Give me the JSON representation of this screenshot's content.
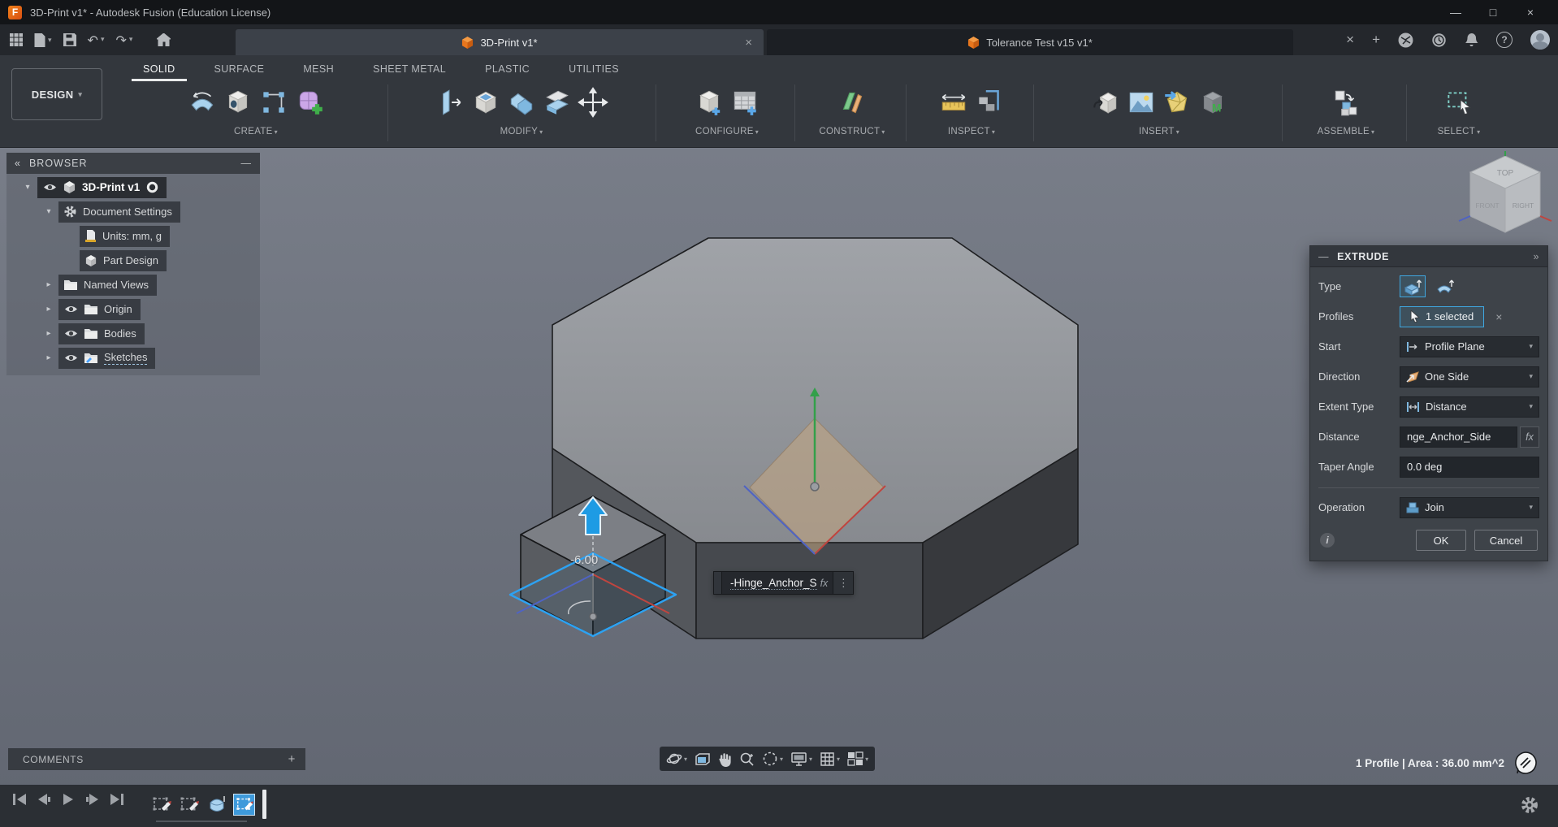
{
  "window": {
    "title": "3D-Print v1* - Autodesk Fusion (Education License)"
  },
  "icons": {
    "caret": "▾",
    "chevron": "▸",
    "close": "×",
    "add": "+",
    "minus": "—",
    "collapse_left": "«",
    "expand_right": "»",
    "kebab": "⋮",
    "help": "?",
    "window_min": "—",
    "window_max": "□",
    "window_close": "×",
    "undo": "↶",
    "redo": "↷",
    "info": "i"
  },
  "doc_tabs": {
    "tabs": [
      {
        "label": "3D-Print v1*"
      },
      {
        "label": "Tolerance Test v15 v1*"
      }
    ]
  },
  "ribbon": {
    "workspace": "DESIGN",
    "tabs": [
      {
        "label": "SOLID"
      },
      {
        "label": "SURFACE"
      },
      {
        "label": "MESH"
      },
      {
        "label": "SHEET METAL"
      },
      {
        "label": "PLASTIC"
      },
      {
        "label": "UTILITIES"
      }
    ],
    "groups": [
      {
        "label": "CREATE"
      },
      {
        "label": "MODIFY"
      },
      {
        "label": "CONFIGURE"
      },
      {
        "label": "CONSTRUCT"
      },
      {
        "label": "INSPECT"
      },
      {
        "label": "INSERT"
      },
      {
        "label": "ASSEMBLE"
      },
      {
        "label": "SELECT"
      }
    ]
  },
  "browser": {
    "header": "BROWSER",
    "items": [
      {
        "label": "3D-Print v1"
      },
      {
        "label": "Document Settings"
      },
      {
        "label": "Units: mm, g"
      },
      {
        "label": "Part Design"
      },
      {
        "label": "Named Views"
      },
      {
        "label": "Origin"
      },
      {
        "label": "Bodies"
      },
      {
        "label": "Sketches"
      }
    ]
  },
  "viewport": {
    "distance_label": "-6.00",
    "dim_input": {
      "value": "-Hinge_Anchor_S",
      "fx": "fx"
    },
    "viewcube": {
      "top": "TOP",
      "front": "FRONT",
      "right": "RIGHT"
    }
  },
  "extrude_dialog": {
    "title": "EXTRUDE",
    "type_label": "Type",
    "profiles_label": "Profiles",
    "profiles_value": "1 selected",
    "start_label": "Start",
    "start_value": "Profile Plane",
    "direction_label": "Direction",
    "direction_value": "One Side",
    "extent_label": "Extent Type",
    "extent_value": "Distance",
    "distance_label": "Distance",
    "distance_value": "nge_Anchor_Side",
    "distance_fx": "fx",
    "taper_label": "Taper Angle",
    "taper_value": "0.0 deg",
    "operation_label": "Operation",
    "operation_value": "Join",
    "ok_label": "OK",
    "cancel_label": "Cancel"
  },
  "comments_panel": {
    "label": "COMMENTS"
  },
  "status_bar": {
    "selection_info": "1 Profile | Area : 36.00 mm^2"
  },
  "colors": {
    "accent_blue": "#3fa7e0",
    "fusion_orange": "#f0811a",
    "manipulator_blue": "#1e9be4"
  }
}
